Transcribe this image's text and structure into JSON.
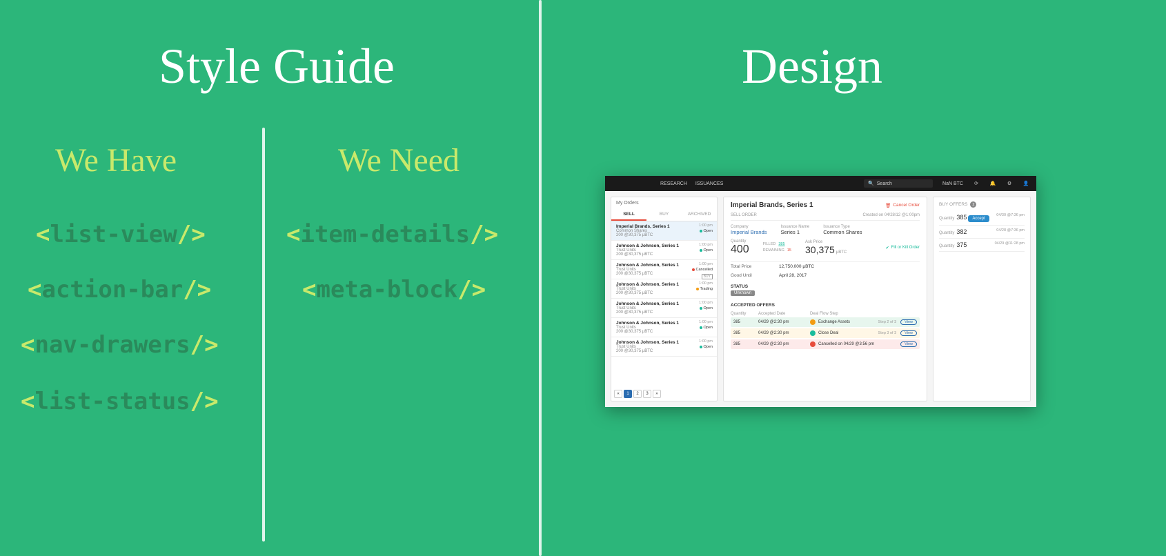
{
  "titles": {
    "style": "Style Guide",
    "design": "Design"
  },
  "subheads": {
    "have": "We Have",
    "need": "We Need"
  },
  "tags": {
    "have": [
      "list-view",
      "action-bar",
      "nav-drawers",
      "list-status"
    ],
    "need": [
      "item-details",
      "meta-block"
    ]
  },
  "mock": {
    "nav": {
      "research": "RESEARCH",
      "issuances": "ISSUANCES"
    },
    "search_placeholder": "Search",
    "balance": "NaN BTC",
    "left": {
      "title": "My Orders",
      "tabs": {
        "sell": "SELL",
        "buy": "BUY",
        "archived": "ARCHIVED"
      },
      "items": [
        {
          "ln1": "Imperial Brands, Series 1",
          "ln2": "Common Shares",
          "ln3": "200 @30,375 µBTC",
          "time": "1:00 pm",
          "stat": "Open",
          "dot": "g",
          "sel": true
        },
        {
          "ln1": "Johnson & Johnson, Series 1",
          "ln2": "Trust Units",
          "ln3": "200 @30,375 µBTC",
          "time": "1:00 pm",
          "stat": "Open",
          "dot": "g"
        },
        {
          "ln1": "Johnson & Johnson, Series 1",
          "ln2": "Trust Units",
          "ln3": "200 @30,375 µBTC",
          "time": "1:00 pm",
          "stat": "Cancelled",
          "dot": "r",
          "badge": "BUY"
        },
        {
          "ln1": "Johnson & Johnson, Series 1",
          "ln2": "Trust Units",
          "ln3": "200 @30,375 µBTC",
          "time": "1:00 pm",
          "stat": "Trading",
          "dot": "o"
        },
        {
          "ln1": "Johnson & Johnson, Series 1",
          "ln2": "Trust Units",
          "ln3": "200 @30,375 µBTC",
          "time": "1:00 pm",
          "stat": "Open",
          "dot": "g"
        },
        {
          "ln1": "Johnson & Johnson, Series 1",
          "ln2": "Trust Units",
          "ln3": "200 @30,375 µBTC",
          "time": "1:00 pm",
          "stat": "Open",
          "dot": "g"
        },
        {
          "ln1": "Johnson & Johnson, Series 1",
          "ln2": "Trust Units",
          "ln3": "200 @30,375 µBTC",
          "time": "1:00 pm",
          "stat": "Open",
          "dot": "g"
        }
      ],
      "pager": [
        "«",
        "1",
        "2",
        "3",
        "»"
      ]
    },
    "mid": {
      "title": "Imperial Brands, Series 1",
      "cancel": "Cancel Order",
      "sell_order": "SELL ORDER",
      "created": "Created on 04/28/12 @1:00pm",
      "company_lbl": "Company",
      "company_val": "Imperial Brands",
      "issuance_lbl": "Issuance Name",
      "issuance_val": "Series 1",
      "type_lbl": "Issuance Type",
      "type_val": "Common Shares",
      "qty_lbl": "Quantity",
      "qty_val": "400",
      "filled_lbl": "FILLED",
      "filled_val": "385",
      "remaining_lbl": "REMAINING",
      "remaining_val": "15",
      "ask_lbl": "Ask Price",
      "ask_val": "30,375",
      "ask_unit": "µBTC",
      "fok": "Fill or Kill Order",
      "total_lbl": "Total Price",
      "total_val": "12,750,000 µBTC",
      "good_lbl": "Good Until",
      "good_val": "April 28, 2017",
      "status_lbl": "STATUS",
      "status_val": "Unknown",
      "ao_title": "ACCEPTED OFFERS",
      "ao_head": {
        "q": "Quantity",
        "d": "Accepted Date",
        "f": "Deal Flow Step"
      },
      "ao_rows": [
        {
          "q": "385",
          "d": "04/29 @2:30 pm",
          "f": "Exchange Assets",
          "step": "Step 2 of 3",
          "bg": "bgg",
          "ic": "mi-g"
        },
        {
          "q": "385",
          "d": "04/29 @2:30 pm",
          "f": "Close Deal",
          "step": "Step 3 of 3",
          "bg": "bgy",
          "ic": "mi-b"
        },
        {
          "q": "385",
          "d": "04/29 @2:30 pm",
          "f": "Cancelled on 04/29 @3:56 pm",
          "step": "",
          "bg": "bgr",
          "ic": "mi-r"
        }
      ],
      "view": "View"
    },
    "right": {
      "title": "BUY OFFERS",
      "count": "2",
      "offers": [
        {
          "q": "385",
          "ts": "04/30 @7:36 pm",
          "accept": true
        },
        {
          "q": "382",
          "ts": "04/28 @7:36 pm"
        },
        {
          "q": "375",
          "ts": "04/29 @11:28 pm"
        }
      ],
      "qty_lbl": "Quantity",
      "accept": "Accept"
    }
  }
}
